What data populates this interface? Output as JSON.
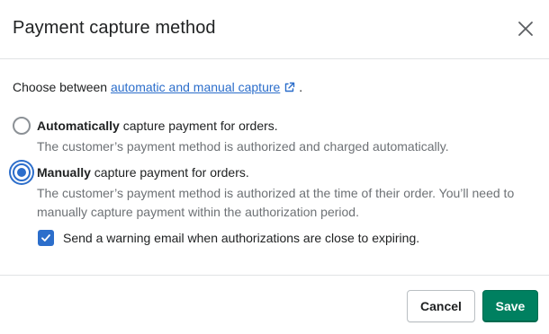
{
  "dialog": {
    "title": "Payment capture method",
    "close_icon": "close-icon"
  },
  "intro": {
    "prefix": "Choose between ",
    "link_text": "automatic and manual capture",
    "suffix": " .",
    "link_icon": "external-link-icon"
  },
  "options": [
    {
      "bold": "Automatically",
      "rest": " capture payment for orders.",
      "help": "The customer’s payment method is authorized and charged automatically.",
      "selected": false
    },
    {
      "bold": "Manually",
      "rest": " capture payment for orders.",
      "help": "The customer’s payment method is authorized at the time of their order. You’ll need to manually capture payment within the authorization period.",
      "selected": true
    }
  ],
  "warning_checkbox": {
    "label": "Send a warning email when authorizations are close to expiring.",
    "checked": true
  },
  "footer": {
    "cancel_label": "Cancel",
    "save_label": "Save"
  },
  "colors": {
    "accent": "#2c6ecb",
    "primary_button": "#008060",
    "subdued_text": "#6d7175"
  }
}
